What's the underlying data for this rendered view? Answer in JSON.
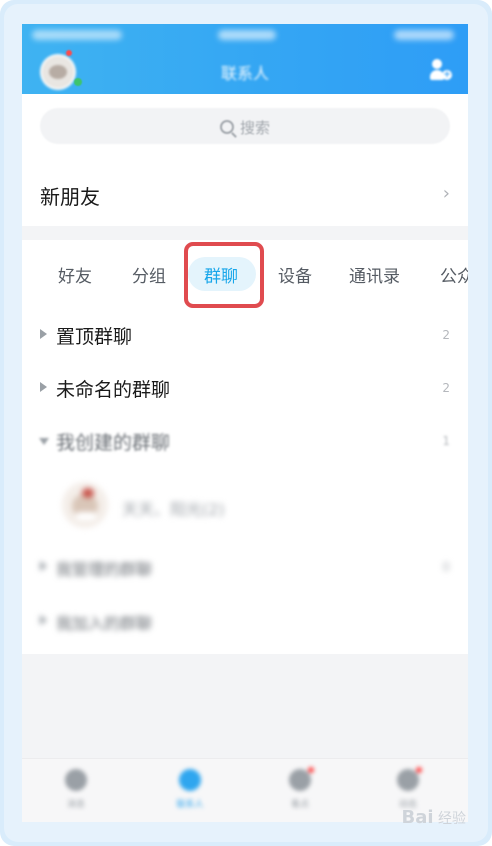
{
  "header": {
    "title": "联系人",
    "icons": {
      "avatar": "avatar",
      "add_friend": "add-friend-icon"
    }
  },
  "search": {
    "placeholder": "搜索"
  },
  "new_friends": {
    "label": "新朋友"
  },
  "tabs": [
    {
      "label": "好友",
      "active": false
    },
    {
      "label": "分组",
      "active": false
    },
    {
      "label": "群聊",
      "active": true
    },
    {
      "label": "设备",
      "active": false
    },
    {
      "label": "通讯录",
      "active": false
    },
    {
      "label": "公众",
      "active": false
    }
  ],
  "groups": [
    {
      "name": "置顶群聊",
      "count": "2",
      "expanded": false
    },
    {
      "name": "未命名的群聊",
      "count": "2",
      "expanded": false
    },
    {
      "name": "我创建的群聊",
      "count": "1",
      "expanded": true
    },
    {
      "name": "我管理的群聊",
      "count": "0",
      "expanded": false
    },
    {
      "name": "我加入的群聊",
      "count": "",
      "expanded": false
    }
  ],
  "contact": {
    "name": "天天、阳光(2)"
  },
  "bottom_nav": [
    {
      "label": "消息",
      "active": false
    },
    {
      "label": "联系人",
      "active": true
    },
    {
      "label": "看点",
      "active": false,
      "badge": true
    },
    {
      "label": "动态",
      "active": false,
      "badge": true
    }
  ],
  "watermark": {
    "brand": "Bai",
    "text": "经验"
  },
  "colors": {
    "accent": "#17a6ea",
    "highlight": "#e04b4f",
    "header": "#35a7f3"
  }
}
